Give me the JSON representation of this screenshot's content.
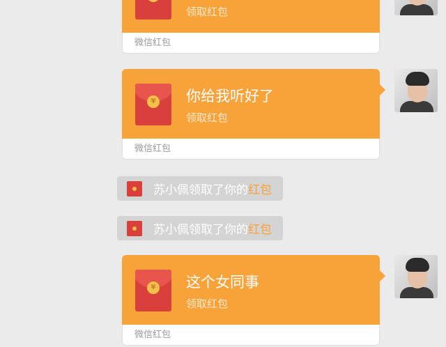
{
  "colors": {
    "accent": "#f8a23a",
    "envelope": "#d9403b",
    "background": "#ebebeb"
  },
  "cards": [
    {
      "message": "",
      "sub": "领取红包",
      "footer": "微信红包"
    },
    {
      "message": "你给我听好了",
      "sub": "领取红包",
      "footer": "微信红包"
    },
    {
      "message": "这个女同事",
      "sub": "领取红包",
      "footer": "微信红包"
    }
  ],
  "notices": [
    {
      "text": "苏小佩领取了你的",
      "highlight": "红包"
    },
    {
      "text": "苏小佩领取了你的",
      "highlight": "红包"
    }
  ],
  "icons": {
    "envelope": "red-envelope-icon",
    "coin": "yuan-coin-icon",
    "avatar": "avatar"
  },
  "coin_symbol": "¥"
}
